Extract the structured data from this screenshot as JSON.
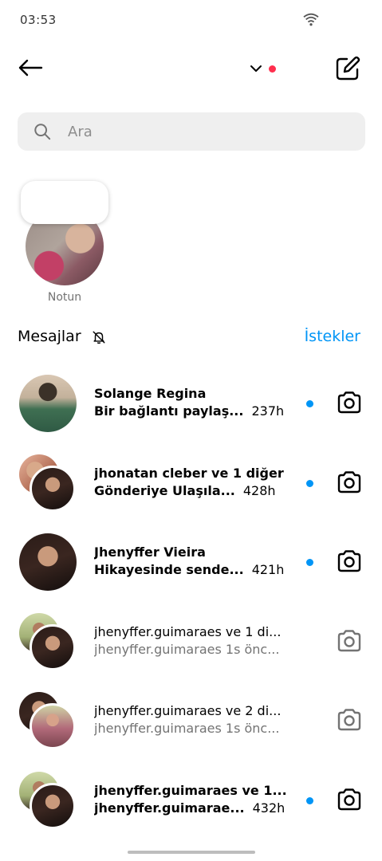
{
  "status_bar": {
    "time": "03:53"
  },
  "header": {
    "back_icon": "arrow-left-icon",
    "switch_icon": "chevron-down-icon",
    "notification_dot_color": "#ff2e4d",
    "compose_icon": "compose-icon"
  },
  "search": {
    "placeholder": "Ara",
    "icon": "search-icon"
  },
  "note": {
    "label": "Notun"
  },
  "section": {
    "title": "Mesajlar",
    "mute_icon": "bell-off-icon",
    "requests_label": "İstekler",
    "link_color": "#0095f6"
  },
  "threads": [
    {
      "name": "Solange Regina",
      "preview": "Bir bağlantı paylaş...",
      "time": "237h",
      "unread": true
    },
    {
      "name": "jhonatan cleber ve 1 diğer",
      "preview": "Gönderiye Ulaşıla...",
      "time": "428h",
      "unread": true
    },
    {
      "name": "Jhenyffer Vieira",
      "preview": "Hikayesinde sende...",
      "time": "421h",
      "unread": true
    },
    {
      "name": "jhenyffer.guimaraes ve 1 di...",
      "preview": "jhenyffer.guimaraes 1s önc...",
      "time": "",
      "unread": false
    },
    {
      "name": "jhenyffer.guimaraes ve 2 di...",
      "preview": "jhenyffer.guimaraes 1s önc...",
      "time": "",
      "unread": false
    },
    {
      "name": "jhenyffer.guimaraes ve 1...",
      "preview": "jhenyffer.guimarae...",
      "time": "432h",
      "unread": true
    }
  ],
  "camera_icon": "camera-icon",
  "unread_color": "#0095f6"
}
